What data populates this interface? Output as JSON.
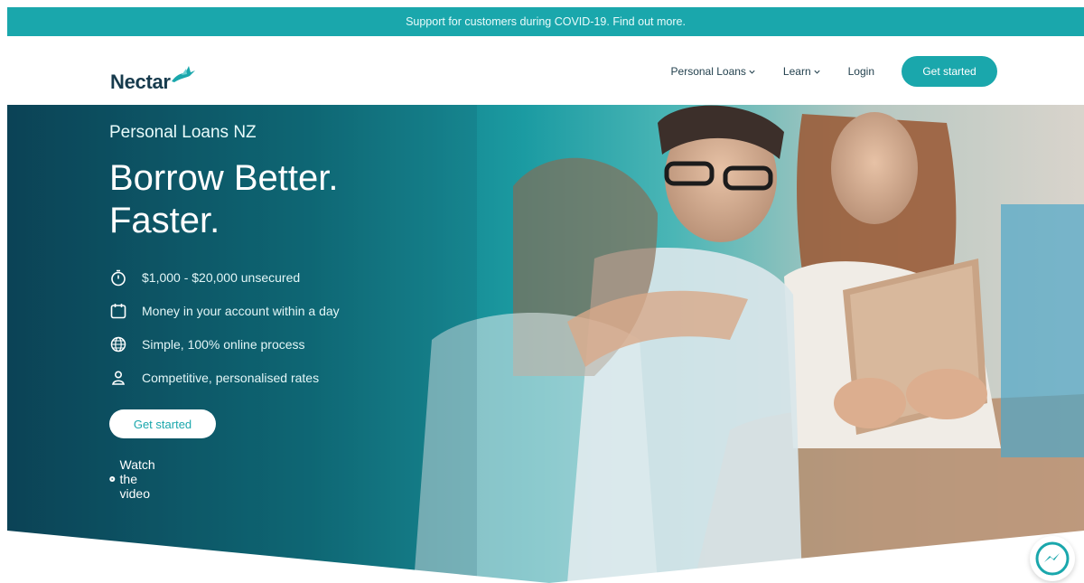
{
  "banner": {
    "text": "Support for customers during COVID-19. Find out more."
  },
  "header": {
    "logo_text": "Nectar",
    "nav": {
      "personal_loans": "Personal Loans",
      "learn": "Learn",
      "login": "Login",
      "get_started": "Get started"
    }
  },
  "hero": {
    "eyebrow": "Personal Loans NZ",
    "title_line1": "Borrow Better.",
    "title_line2": "Faster.",
    "features": [
      {
        "icon": "stopwatch-icon",
        "label": "$1,000 - $20,000 unsecured"
      },
      {
        "icon": "calendar-icon",
        "label": "Money in your account within a day"
      },
      {
        "icon": "globe-icon",
        "label": "Simple, 100% online process"
      },
      {
        "icon": "person-icon",
        "label": "Competitive, personalised rates"
      }
    ],
    "cta": "Get started",
    "video_link": "Watch the video"
  },
  "colors": {
    "brand_teal": "#1aa7ac",
    "hero_dark": "#0b4356",
    "logo_navy": "#173b4d"
  }
}
